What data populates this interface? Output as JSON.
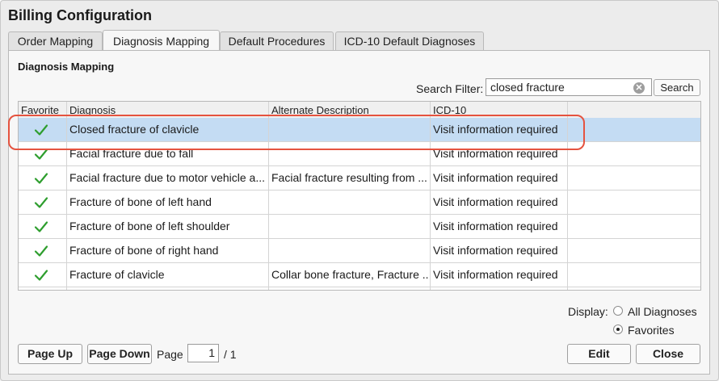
{
  "window": {
    "title": "Billing Configuration"
  },
  "tabs": [
    {
      "label": "Order Mapping"
    },
    {
      "label": "Diagnosis Mapping"
    },
    {
      "label": "Default Procedures"
    },
    {
      "label": "ICD-10 Default Diagnoses"
    }
  ],
  "section_title": "Diagnosis Mapping",
  "search": {
    "label": "Search Filter:",
    "value": "closed fracture",
    "button": "Search"
  },
  "table": {
    "headers": [
      "Favorite",
      "Diagnosis",
      "Alternate Description",
      "ICD-10"
    ],
    "rows": [
      {
        "favorite": true,
        "diagnosis": "Closed fracture of clavicle",
        "alternate": "",
        "icd10": "Visit information required"
      },
      {
        "favorite": true,
        "diagnosis": "Facial fracture due to fall",
        "alternate": "",
        "icd10": "Visit information required"
      },
      {
        "favorite": true,
        "diagnosis": "Facial fracture due to motor vehicle a...",
        "alternate": "Facial fracture resulting from ...",
        "icd10": "Visit information required"
      },
      {
        "favorite": true,
        "diagnosis": "Fracture of bone of left hand",
        "alternate": "",
        "icd10": "Visit information required"
      },
      {
        "favorite": true,
        "diagnosis": "Fracture of bone of left shoulder",
        "alternate": "",
        "icd10": "Visit information required"
      },
      {
        "favorite": true,
        "diagnosis": "Fracture of bone of right hand",
        "alternate": "",
        "icd10": "Visit information required"
      },
      {
        "favorite": true,
        "diagnosis": "Fracture of clavicle",
        "alternate": "Collar bone fracture, Fracture ...",
        "icd10": "Visit information required"
      }
    ]
  },
  "display": {
    "label": "Display:",
    "options": [
      "All Diagnoses",
      "Favorites"
    ],
    "selected": "Favorites"
  },
  "pagination": {
    "page_up": "Page Up",
    "page_down": "Page Down",
    "page_label": "Page",
    "current": "1",
    "total": "/ 1"
  },
  "actions": {
    "edit": "Edit",
    "close": "Close"
  },
  "colors": {
    "check": "#2e9e2e",
    "selection": "#c4dcf3",
    "highlight_ring": "#e5533f"
  }
}
